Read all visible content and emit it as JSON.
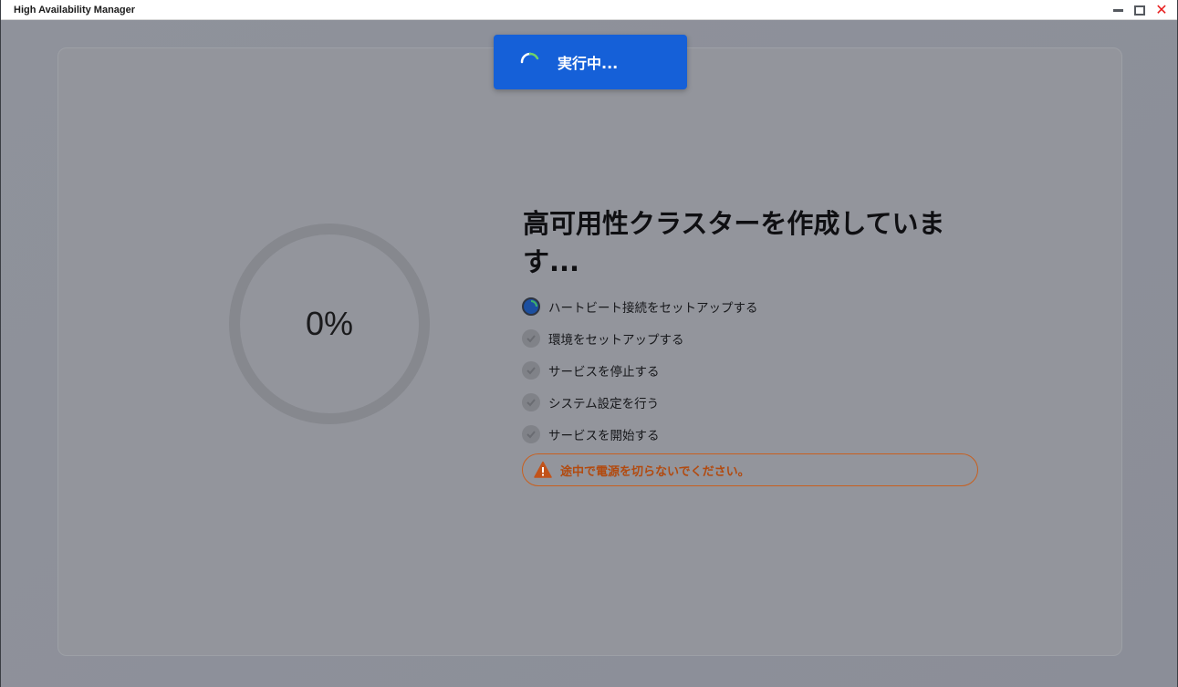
{
  "window": {
    "title": "High Availability Manager",
    "controls": {
      "minimize": "minimize-icon",
      "maximize": "maximize-icon",
      "close": "close-icon"
    }
  },
  "toast": {
    "text": "実行中..."
  },
  "progress": {
    "value": 0,
    "label": "0%"
  },
  "heading": "高可用性クラスターを作成しています...",
  "steps": [
    {
      "label": "ハートビート接続をセットアップする",
      "status": "in-progress"
    },
    {
      "label": "環境をセットアップする",
      "status": "pending"
    },
    {
      "label": "サービスを停止する",
      "status": "pending"
    },
    {
      "label": "システム設定を行う",
      "status": "pending"
    },
    {
      "label": "サービスを開始する",
      "status": "pending"
    }
  ],
  "warning": {
    "icon": "warning-icon",
    "text": "途中で電源を切らないでください。"
  },
  "colors": {
    "accent": "#1560d8",
    "warning": "#c8601f",
    "overlay": "#8c8f9a"
  }
}
